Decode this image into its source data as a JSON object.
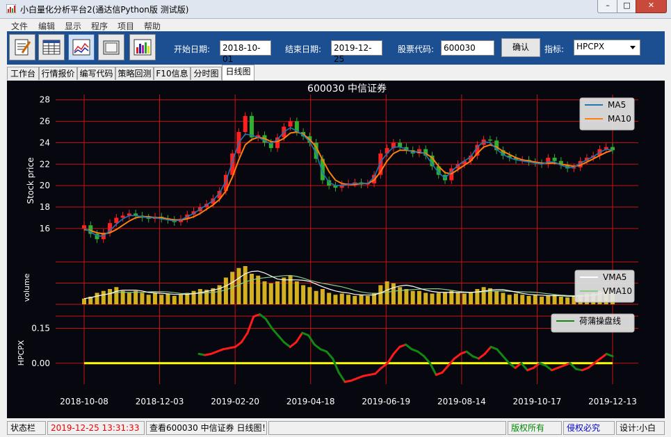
{
  "window": {
    "title": "小白量化分析平台2(通达信Python版 测试版)"
  },
  "menu": [
    "文件",
    "编辑",
    "显示",
    "程序",
    "项目",
    "帮助"
  ],
  "toolbar": {
    "start_label": "开始日期:",
    "start_value": "2018-10-01",
    "end_label": "结束日期:",
    "end_value": "2019-12-25",
    "code_label": "股票代码:",
    "code_value": "600030",
    "confirm_label": "确认",
    "indicator_label": "指标:",
    "indicator_value": "HPCPX",
    "buttons": [
      "notepad-icon",
      "table-icon",
      "line-chart-icon",
      "folder-icon",
      "bar-chart-icon"
    ]
  },
  "tabs": [
    "工作台",
    "行情报价",
    "编写代码",
    "策略回测",
    "F10信息",
    "分时图",
    "日线图"
  ],
  "active_tab": "日线图",
  "status": {
    "label": "状态栏",
    "datetime": "2019-12-25  13:31:33",
    "message": "查看600030 中信证券 日线图！",
    "rights": "版权所有",
    "infringe": "侵权必究",
    "designer": "设计:小白"
  },
  "chart_data": {
    "type": "line",
    "title": "600030  中信证券",
    "price_ylabel": "Stock price",
    "volume_ylabel": "volume",
    "indicator_ylabel": "HPCPX",
    "price_yticks": [
      "28",
      "26",
      "24",
      "22",
      "20",
      "18",
      "16"
    ],
    "price_ylim": [
      14.5,
      28.5
    ],
    "indicator_yticks": [
      "0.15",
      "0.00"
    ],
    "indicator_ylim": [
      -0.09,
      0.22
    ],
    "x_ticks": [
      "2018-10-08",
      "2018-12-03",
      "2019-02-20",
      "2019-04-18",
      "2019-06-19",
      "2019-08-14",
      "2019-10-17",
      "2019-12-13"
    ],
    "legend_price": [
      "MA5",
      "MA10"
    ],
    "legend_volume": [
      "VMA5",
      "VMA10"
    ],
    "legend_indicator": [
      "荷蒲操盘线"
    ],
    "colors": {
      "up": "#ff2020",
      "down": "#2fb02f",
      "ma5": "#1f77b4",
      "ma10": "#ff7f0e",
      "grid": "#cc1111",
      "volume": "#d4b020",
      "vma5": "#ffffff",
      "vma10": "#88cc88",
      "zero_line": "#ffff00",
      "hp_up": "#ff1a1a",
      "hp_down": "#118811"
    },
    "price_close": [
      16.3,
      15.5,
      15.0,
      15.6,
      16.5,
      17.0,
      17.2,
      17.4,
      17.2,
      17.0,
      16.9,
      17.1,
      16.9,
      16.8,
      16.6,
      16.9,
      17.3,
      17.6,
      18.0,
      18.3,
      18.8,
      19.5,
      21.0,
      23.0,
      25.0,
      26.5,
      24.5,
      24.7,
      24.0,
      23.5,
      24.5,
      25.5,
      26.0,
      25.0,
      24.6,
      24.0,
      22.5,
      20.5,
      20.0,
      19.8,
      20.1,
      20.2,
      20.3,
      20.1,
      20.2,
      21.0,
      23.0,
      23.5,
      24.0,
      23.6,
      23.3,
      23.0,
      23.4,
      22.8,
      21.8,
      21.0,
      20.5,
      21.6,
      22.0,
      22.3,
      22.8,
      23.8,
      24.3,
      24.2,
      23.3,
      22.8,
      22.6,
      22.4,
      22.4,
      22.2,
      22.1,
      22.0,
      22.6,
      22.3,
      21.9,
      21.6,
      21.7,
      22.3,
      22.6,
      22.8,
      23.4,
      23.6,
      23.3
    ],
    "ma5": [
      16.0,
      15.7,
      15.3,
      15.3,
      15.8,
      16.4,
      16.9,
      17.2,
      17.2,
      17.1,
      17.0,
      17.0,
      16.9,
      16.8,
      16.7,
      16.8,
      17.1,
      17.4,
      17.8,
      18.2,
      18.6,
      19.3,
      20.4,
      22.2,
      24.0,
      24.8,
      24.7,
      24.5,
      24.2,
      23.9,
      24.3,
      25.0,
      25.4,
      25.1,
      24.7,
      24.1,
      23.0,
      21.2,
      20.3,
      20.0,
      20.0,
      20.1,
      20.2,
      20.2,
      20.2,
      20.8,
      22.2,
      23.0,
      23.6,
      23.6,
      23.4,
      23.1,
      23.2,
      22.9,
      22.0,
      21.2,
      20.7,
      21.3,
      21.9,
      22.3,
      22.7,
      23.6,
      24.1,
      24.0,
      23.4,
      22.9,
      22.6,
      22.4,
      22.3,
      22.2,
      22.1,
      22.0,
      22.2,
      22.2,
      21.9,
      21.7,
      21.7,
      22.1,
      22.4,
      22.7,
      23.1,
      23.4,
      23.3
    ],
    "ma10": [
      15.9,
      15.8,
      15.6,
      15.5,
      15.6,
      15.9,
      16.3,
      16.7,
      17.0,
      17.1,
      17.1,
      17.0,
      17.0,
      16.9,
      16.8,
      16.8,
      16.9,
      17.1,
      17.4,
      17.8,
      18.2,
      18.7,
      19.5,
      20.8,
      22.4,
      23.8,
      24.3,
      24.5,
      24.4,
      24.1,
      24.1,
      24.4,
      24.9,
      25.0,
      24.8,
      24.3,
      23.6,
      22.4,
      21.3,
      20.5,
      20.2,
      20.1,
      20.1,
      20.2,
      20.2,
      20.5,
      21.3,
      22.3,
      23.0,
      23.3,
      23.3,
      23.2,
      23.1,
      23.0,
      22.6,
      21.8,
      21.2,
      21.1,
      21.5,
      21.9,
      22.3,
      23.0,
      23.6,
      23.8,
      23.6,
      23.2,
      22.9,
      22.6,
      22.4,
      22.3,
      22.2,
      22.1,
      22.1,
      22.1,
      22.0,
      21.9,
      21.8,
      21.9,
      22.2,
      22.5,
      22.8,
      23.1,
      23.3
    ],
    "volume": [
      0.15,
      0.2,
      0.3,
      0.35,
      0.4,
      0.45,
      0.35,
      0.3,
      0.35,
      0.3,
      0.25,
      0.3,
      0.25,
      0.28,
      0.22,
      0.25,
      0.3,
      0.35,
      0.4,
      0.38,
      0.42,
      0.5,
      0.7,
      0.85,
      0.95,
      1.0,
      0.8,
      0.75,
      0.6,
      0.55,
      0.6,
      0.7,
      0.75,
      0.6,
      0.5,
      0.45,
      0.35,
      0.4,
      0.3,
      0.25,
      0.28,
      0.25,
      0.22,
      0.24,
      0.22,
      0.3,
      0.5,
      0.6,
      0.55,
      0.45,
      0.4,
      0.35,
      0.35,
      0.3,
      0.28,
      0.3,
      0.32,
      0.35,
      0.3,
      0.28,
      0.3,
      0.4,
      0.45,
      0.42,
      0.35,
      0.3,
      0.25,
      0.28,
      0.25,
      0.22,
      0.25,
      0.2,
      0.22,
      0.25,
      0.2,
      0.18,
      0.2,
      0.25,
      0.28,
      0.3,
      0.35,
      0.4,
      0.3
    ],
    "hpcpx": [
      0.04,
      0.035,
      0.04,
      0.05,
      0.06,
      0.065,
      0.07,
      0.09,
      0.13,
      0.2,
      0.21,
      0.19,
      0.15,
      0.12,
      0.09,
      0.07,
      0.09,
      0.13,
      0.12,
      0.08,
      0.06,
      0.05,
      0.02,
      -0.04,
      -0.08,
      -0.075,
      -0.065,
      -0.055,
      -0.05,
      -0.045,
      -0.02,
      0.0,
      0.04,
      0.07,
      0.08,
      0.06,
      0.05,
      0.03,
      0.0,
      -0.05,
      -0.04,
      -0.01,
      0.02,
      0.04,
      0.05,
      0.03,
      0.02,
      0.04,
      0.07,
      0.06,
      0.03,
      0.0,
      -0.02,
      0.0,
      -0.03,
      -0.02,
      0.0,
      -0.01,
      -0.03,
      -0.02,
      -0.01,
      0.0,
      -0.025,
      -0.03,
      -0.02,
      0.0,
      0.02,
      0.04,
      0.03
    ]
  }
}
